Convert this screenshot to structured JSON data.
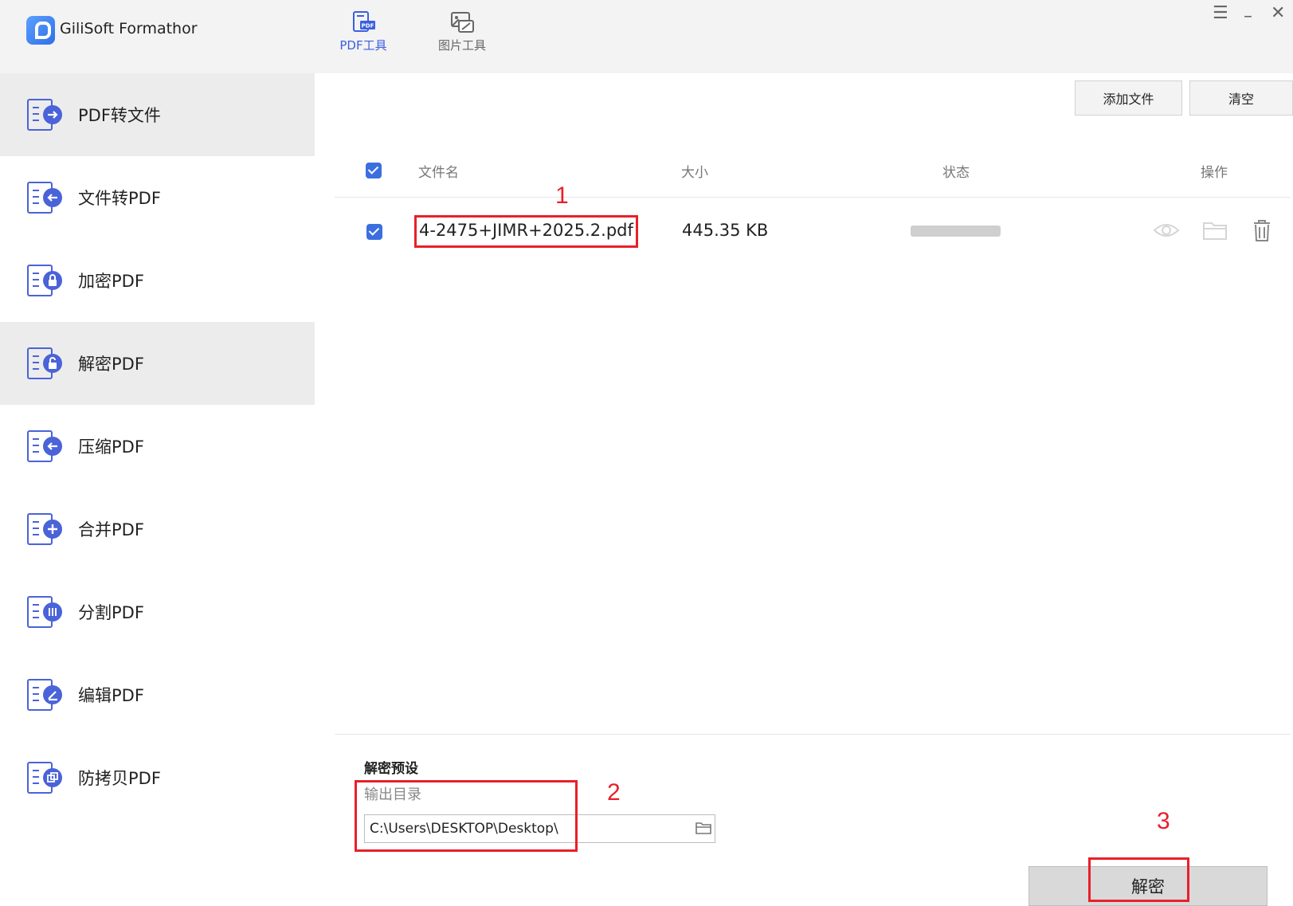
{
  "app": {
    "title": "GiliSoft Formathor"
  },
  "top_tabs": [
    {
      "label": "PDF工具",
      "icon": "pdf-tool-icon",
      "active": true
    },
    {
      "label": "图片工具",
      "icon": "image-tool-icon",
      "active": false
    }
  ],
  "sidebar": {
    "items": [
      {
        "label": "PDF转文件",
        "icon": "pdf-to-file-icon",
        "active": true
      },
      {
        "label": "文件转PDF",
        "icon": "file-to-pdf-icon",
        "active": false
      },
      {
        "label": "加密PDF",
        "icon": "encrypt-pdf-icon",
        "active": false
      },
      {
        "label": "解密PDF",
        "icon": "decrypt-pdf-icon",
        "active": true
      },
      {
        "label": "压缩PDF",
        "icon": "compress-pdf-icon",
        "active": false
      },
      {
        "label": "合并PDF",
        "icon": "merge-pdf-icon",
        "active": false
      },
      {
        "label": "分割PDF",
        "icon": "split-pdf-icon",
        "active": false
      },
      {
        "label": "编辑PDF",
        "icon": "edit-pdf-icon",
        "active": false
      },
      {
        "label": "防拷贝PDF",
        "icon": "copy-protect-pdf-icon",
        "active": false
      }
    ]
  },
  "toolbar": {
    "add_file_label": "添加文件",
    "clear_label": "清空"
  },
  "table": {
    "headers": {
      "filename": "文件名",
      "size": "大小",
      "status": "状态",
      "actions": "操作"
    },
    "rows": [
      {
        "checked": true,
        "filename": "4-2475+JIMR+2025.2.pdf",
        "size": "445.35 KB"
      }
    ]
  },
  "settings": {
    "section_title": "解密预设",
    "output_label": "输出目录",
    "output_path": "C:\\Users\\DESKTOP\\Desktop\\"
  },
  "main_action": {
    "label": "解密"
  },
  "annotations": {
    "n1": "1",
    "n2": "2",
    "n3": "3",
    "color": "#e8202a"
  },
  "colors": {
    "accent": "#3b6fe0",
    "sidebar_active": "#ececec"
  }
}
